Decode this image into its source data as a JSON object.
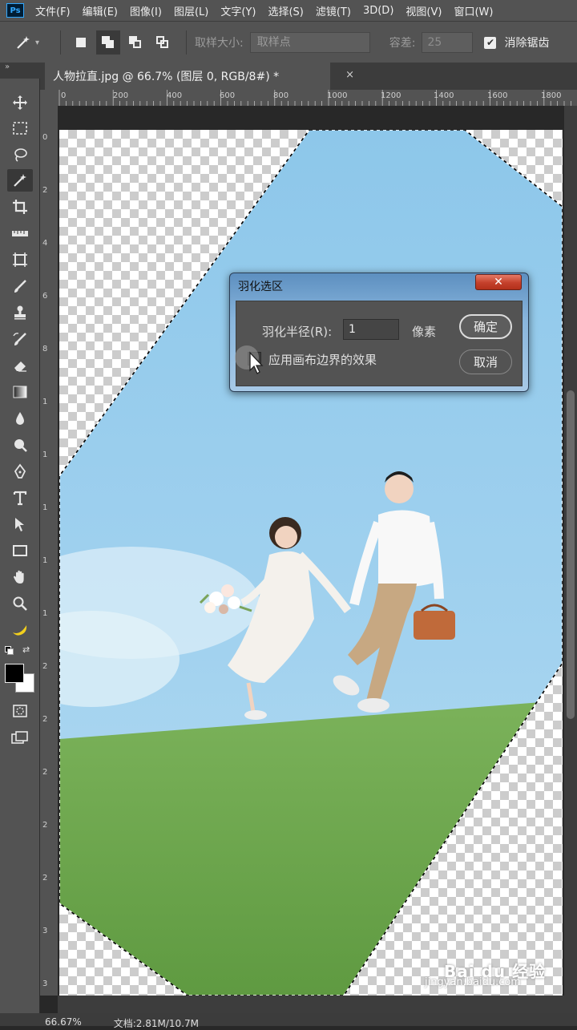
{
  "app": {
    "logo": "Ps"
  },
  "menu": [
    "文件(F)",
    "编辑(E)",
    "图像(I)",
    "图层(L)",
    "文字(Y)",
    "选择(S)",
    "滤镜(T)",
    "3D(D)",
    "视图(V)",
    "窗口(W)"
  ],
  "options_bar": {
    "tool_icon": "magic-wand-icon",
    "sample_size_label": "取样大小:",
    "sample_size_value": "取样点",
    "tolerance_label": "容差:",
    "tolerance_value": "25",
    "anti_alias_label": "消除锯齿",
    "anti_alias_checked": true
  },
  "toolbar_collapse": "»",
  "document_tab": {
    "title": "人物拉直.jpg @ 66.7% (图层 0, RGB/8#) *",
    "close": "×"
  },
  "ruler": {
    "top_labels": [
      "0",
      "200",
      "400",
      "600",
      "800",
      "1000",
      "1200",
      "1400",
      "1600",
      "1800"
    ],
    "left_labels": [
      "0",
      "2",
      "4",
      "6",
      "8",
      "1",
      "1",
      "1",
      "1",
      "1",
      "2",
      "2",
      "2",
      "2",
      "2",
      "3",
      "3"
    ]
  },
  "dialog": {
    "title": "羽化选区",
    "close": "✕",
    "radius_label": "羽化半径(R):",
    "radius_value": "1",
    "unit": "像素",
    "checkbox_label": "应用画布边界的效果",
    "checkbox_checked": false,
    "ok_label": "确定",
    "cancel_label": "取消"
  },
  "status": {
    "zoom": "66.67%",
    "doc": "文档:2.81M/10.7M"
  },
  "watermark": {
    "logo": "Bai du 经验",
    "url": "jingyan.baidu.com"
  },
  "colors": {
    "sky": "#8cc8ea",
    "grass": "#6ea54d",
    "ui_panel": "#535353",
    "dialog_frame": "#89b6dd",
    "close_red": "#c4402b"
  }
}
